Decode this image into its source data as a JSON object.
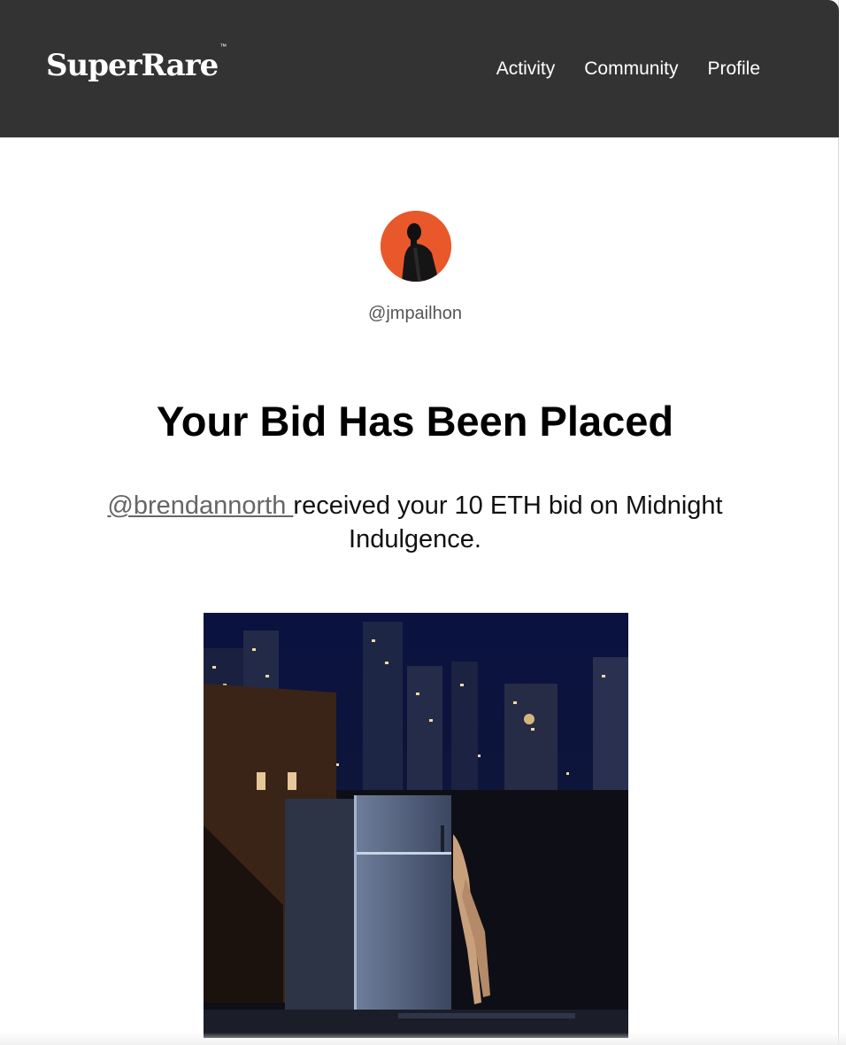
{
  "header": {
    "logo_text": "SuperRare",
    "logo_mark": "™",
    "nav": [
      {
        "label": "Activity"
      },
      {
        "label": "Community"
      },
      {
        "label": "Profile"
      }
    ],
    "background_color": "#333333"
  },
  "profile": {
    "avatar_icon": "avatar-silhouette",
    "avatar_color": "#e8582a",
    "username": "@jmpailhon"
  },
  "main": {
    "title": "Your Bid Has Been Placed",
    "recipient_link": "@brendannorth ",
    "message_text": "received your 10 ETH bid on Midnight Indulgence."
  },
  "artwork": {
    "image_icon": "artwork-night-city-refrigerator"
  }
}
